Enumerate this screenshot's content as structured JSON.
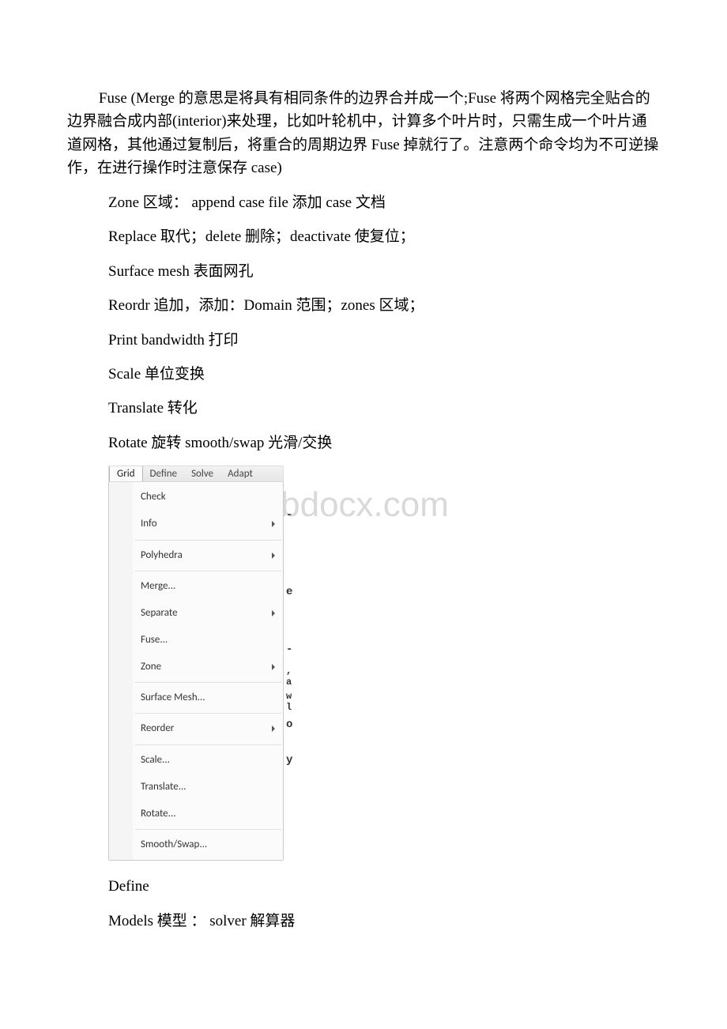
{
  "paragraphs": {
    "p1": "Fuse (Merge 的意思是将具有相同条件的边界合并成一个;Fuse 将两个网格完全贴合的边界融合成内部(interior)来处理，比如叶轮机中，计算多个叶片时，只需生成一个叶片通道网格，其他通过复制后，将重合的周期边界 Fuse 掉就行了。注意两个命令均为不可逆操作，在进行操作时注意保存 case)",
    "p2": "Zone 区域： append case file 添加 case 文档",
    "p3": " Replace 取代；delete 删除；deactivate 使复位；",
    "p4": "Surface mesh 表面网孔",
    "p5": "Reordr 追加，添加：Domain 范围；zones 区域；",
    "p6": " Print bandwidth 打印",
    "p7": "Scale 单位变换",
    "p8": "Translate 转化",
    "p9": "Rotate 旋转 smooth/swap 光滑/交换",
    "p10": "Define",
    "p11": "Models 模型 ： solver 解算器"
  },
  "menubar": {
    "grid": "Grid",
    "define": "Define",
    "solve": "Solve",
    "adapt": "Adapt"
  },
  "dropdown": {
    "check": "Check",
    "info": "Info",
    "polyhedra": "Polyhedra",
    "merge": "Merge...",
    "separate": "Separate",
    "fuse": "Fuse...",
    "zone": "Zone",
    "surface_mesh": "Surface Mesh...",
    "reorder": "Reorder",
    "scale": "Scale...",
    "translate": "Translate...",
    "rotate": "Rotate...",
    "smooth_swap": "Smooth/Swap..."
  },
  "side_chars": {
    "c1": "-",
    "c2": "e",
    "c3": "-",
    "c4": ",\na",
    "c5": "w\nl",
    "c6": "o",
    "c7": "y"
  },
  "watermark": "www.bdocx.com"
}
